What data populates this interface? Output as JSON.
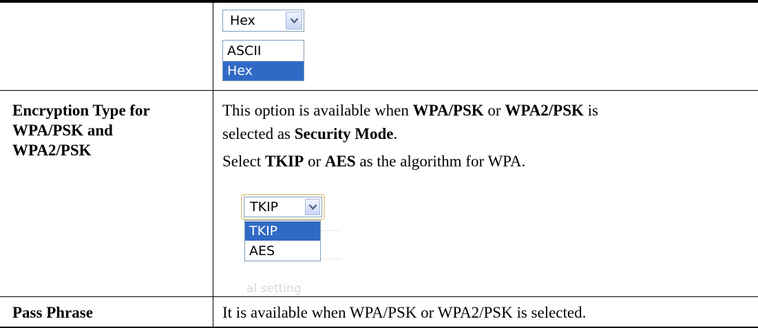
{
  "rows": [
    {
      "label": [],
      "widget": {
        "select_value": "Hex",
        "options": [
          "ASCII",
          "Hex"
        ],
        "selected_option": "Hex"
      }
    },
    {
      "label": [
        "Encryption Type for",
        "WPA/PSK and",
        "WPA2/PSK"
      ],
      "desc_line1": [
        "This option is available when ",
        "WPA/PSK",
        " or ",
        "WPA2/PSK",
        " is"
      ],
      "desc_line2": [
        "selected as ",
        "Security Mode",
        "."
      ],
      "desc_line3": [
        "Select ",
        "TKIP",
        " or ",
        "AES",
        " as the algorithm for WPA."
      ],
      "widget": {
        "select_value": "TKIP",
        "options": [
          "TKIP",
          "AES"
        ],
        "selected_option": "TKIP",
        "faded_text": "al setting"
      }
    },
    {
      "label": [
        "Pass Phrase"
      ],
      "desc": "It is available when WPA/PSK or WPA2/PSK is selected."
    }
  ]
}
